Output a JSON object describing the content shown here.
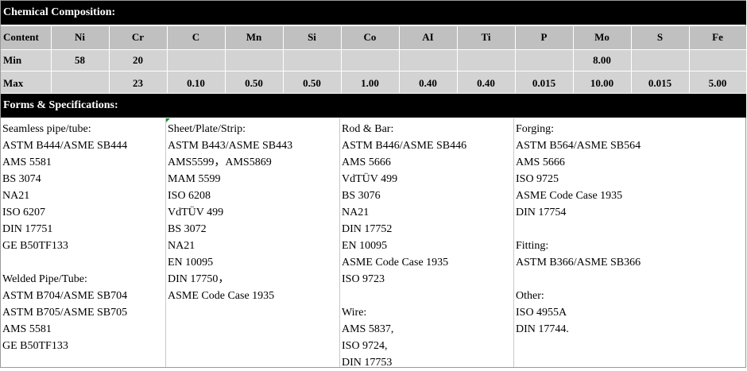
{
  "chemical_header": "Chemical Composition:",
  "composition": {
    "headers": [
      "Content",
      "Ni",
      "Cr",
      "C",
      "Mn",
      "Si",
      "Co",
      "AI",
      "Ti",
      "P",
      "Mo",
      "S",
      "Fe"
    ],
    "rows": [
      [
        "Min",
        "58",
        "20",
        "",
        "",
        "",
        "",
        "",
        "",
        "",
        "8.00",
        "",
        ""
      ],
      [
        "Max",
        "",
        "23",
        "0.10",
        "0.50",
        "0.50",
        "1.00",
        "0.40",
        "0.40",
        "0.015",
        "10.00",
        "0.015",
        "5.00"
      ]
    ]
  },
  "forms_header": "Forms & Specifications:",
  "columns": [
    [
      "Seamless pipe/tube:",
      "ASTM B444/ASME SB444",
      "AMS 5581",
      "BS 3074",
      "NA21",
      "ISO 6207",
      "DIN 17751",
      "GE B50TF133",
      "",
      "Welded Pipe/Tube:",
      "ASTM B704/ASME SB704",
      "ASTM B705/ASME SB705",
      "AMS 5581",
      "GE B50TF133"
    ],
    [
      "Sheet/Plate/Strip:",
      "ASTM B443/ASME SB443",
      "AMS5599，AMS5869",
      "MAM 5599",
      "ISO 6208",
      "VdTÜV 499",
      "BS 3072",
      "NA21",
      "EN 10095",
      "DIN 17750，",
      "ASME Code Case 1935"
    ],
    [
      "Rod & Bar:",
      "ASTM B446/ASME SB446",
      "AMS 5666",
      "VdTÜV 499",
      "BS 3076",
      "NA21",
      "DIN 17752",
      "EN 10095",
      "ASME Code Case 1935",
      "ISO 9723",
      "",
      "Wire:",
      "AMS 5837,",
      "ISO 9724,",
      "DIN 17753"
    ],
    [
      "Forging:",
      "ASTM B564/ASME SB564",
      "AMS 5666",
      "ISO 9725",
      "ASME Code Case 1935",
      "DIN 17754",
      "",
      "Fitting:",
      "ASTM B366/ASME SB366",
      "",
      "Other:",
      "ISO 4955A",
      "DIN 17744."
    ]
  ]
}
